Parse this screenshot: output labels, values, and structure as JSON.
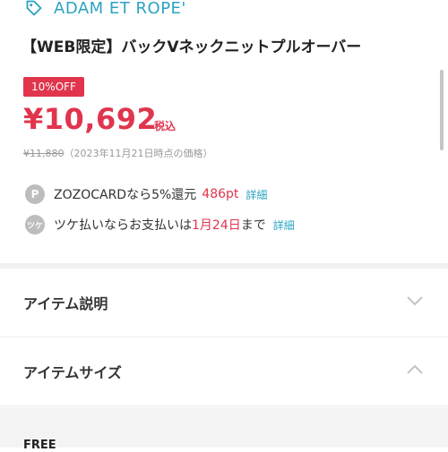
{
  "brand": {
    "name": "ADAM ET ROPE'",
    "icon": "tag-icon"
  },
  "product": {
    "title": "【WEB限定】バックVネックニットプルオーバー",
    "discount_badge": "10%OFF",
    "price": "¥10,692",
    "tax_label": "税込",
    "original_price": "¥11,880",
    "price_note": "（2023年11月21日時点の価格）"
  },
  "points": {
    "icon_letter": "P",
    "text": "ZOZOCARDなら5%還元",
    "points_value": "486pt",
    "detail_link": "詳細"
  },
  "tsuke": {
    "icon_letter": "ツケ",
    "text_before": "ツケ払いならお支払いは",
    "date": "1月24日",
    "text_after": "まで",
    "detail_link": "詳細"
  },
  "accordion": [
    {
      "label": "アイテム説明",
      "state": "collapsed",
      "icon": "chevron-down-icon"
    },
    {
      "label": "アイテムサイズ",
      "state": "expanded",
      "icon": "chevron-up-icon"
    }
  ],
  "size_section": {
    "first_row_label": "FREE"
  },
  "colors": {
    "accent_red": "#e0354d",
    "link_blue": "#2aa3c2",
    "icon_gray": "#bdbdbd"
  }
}
